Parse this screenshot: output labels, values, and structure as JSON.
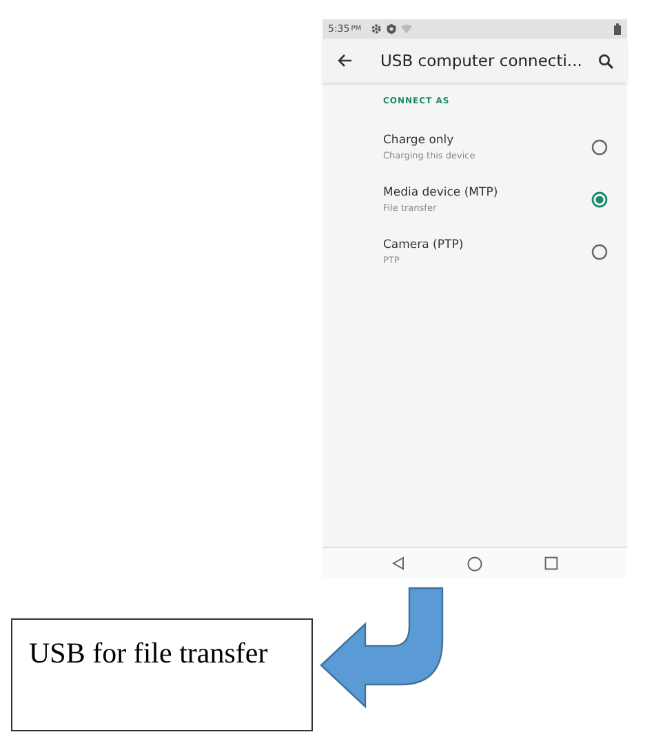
{
  "status_bar": {
    "time": "5:35",
    "ampm": "PM"
  },
  "app_bar": {
    "title": "USB computer connecti..."
  },
  "section_header": "CONNECT AS",
  "options": [
    {
      "title": "Charge only",
      "subtitle": "Charging this device",
      "selected": false
    },
    {
      "title": "Media device (MTP)",
      "subtitle": "File transfer",
      "selected": true
    },
    {
      "title": "Camera (PTP)",
      "subtitle": "PTP",
      "selected": false
    }
  ],
  "callout": {
    "text": "USB for file transfer"
  }
}
